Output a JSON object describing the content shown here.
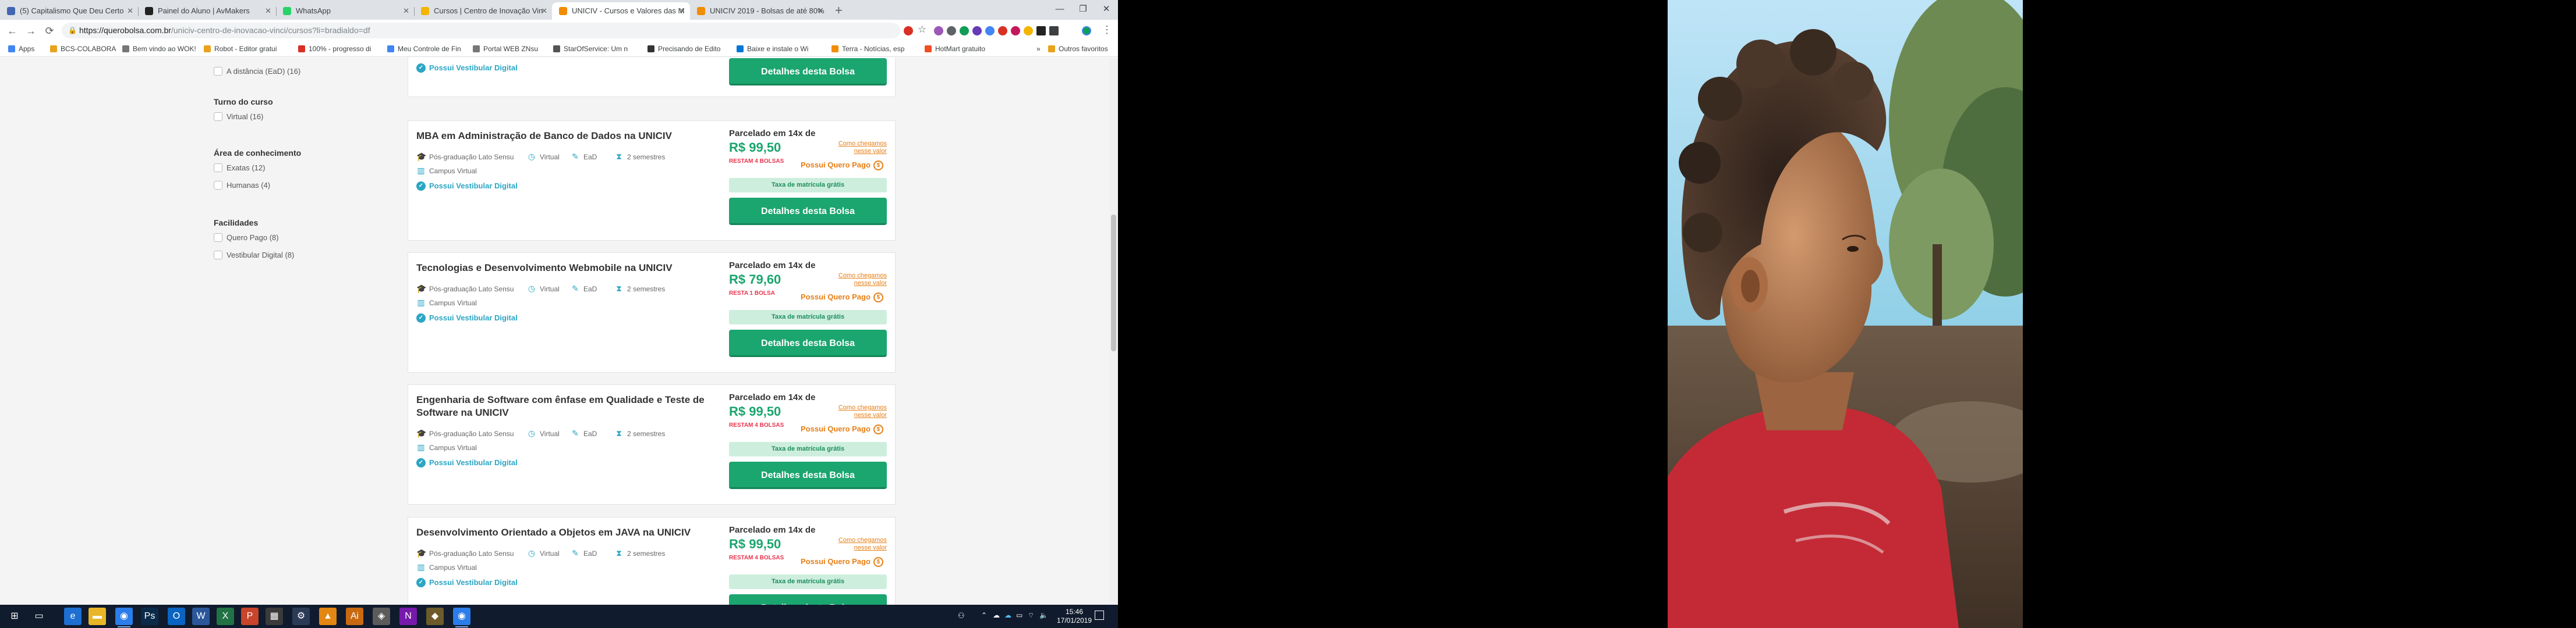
{
  "browser": {
    "tabs": [
      {
        "title": "(5) Capitalismo Que Deu Certo",
        "favicon_color": "#4267b2",
        "active": false
      },
      {
        "title": "Painel do Aluno | AvMakers",
        "favicon_color": "#222222",
        "active": false
      },
      {
        "title": "WhatsApp",
        "favicon_color": "#25d366",
        "active": false
      },
      {
        "title": "Cursos | Centro de Inovação Vin",
        "favicon_color": "#f4b400",
        "active": false
      },
      {
        "title": "UNICIV - Cursos e Valores das M",
        "favicon_color": "#f28c00",
        "active": true
      },
      {
        "title": "UNICIV 2019 - Bolsas de até 80%",
        "favicon_color": "#f28c00",
        "active": false
      }
    ],
    "new_tab": "+",
    "window_controls": {
      "minimize": "—",
      "maximize": "❐",
      "close": "✕"
    },
    "nav": {
      "back": "←",
      "forward": "→",
      "reload": "⟳"
    },
    "url": {
      "host": "https://querobolsa.com.br",
      "path": "/uniciv-centro-de-inovacao-vinci/cursos?li=bradialdo=df"
    },
    "bookmarks": [
      {
        "label": "Apps",
        "color": "#4285f4"
      },
      {
        "label": "BCS-COLABORA",
        "color": "#e8a21b"
      },
      {
        "label": "Bem vindo ao WOK!",
        "color": "#777777"
      },
      {
        "label": "Robot - Editor gratui",
        "color": "#e8a21b"
      },
      {
        "label": "100% - progresso di",
        "color": "#d93025"
      },
      {
        "label": "Meu Controle de Fin",
        "color": "#4285f4"
      },
      {
        "label": "Portal WEB ZNsu",
        "color": "#777777"
      },
      {
        "label": "StarOfService: Um n",
        "color": "#555555"
      },
      {
        "label": "Precisando de Edito",
        "color": "#333333"
      },
      {
        "label": "Baixe e instale o Wi",
        "color": "#0078d7"
      },
      {
        "label": "Terra - Notícias, esp",
        "color": "#f28c00"
      },
      {
        "label": "HotMart gratuito",
        "color": "#f04e23"
      },
      {
        "label": "»",
        "color": "#ffffff"
      },
      {
        "label": "Outros favoritos",
        "color": "#e8a21b"
      }
    ]
  },
  "sidebar": {
    "top_option": "A distância (EaD) (16)",
    "groups": [
      {
        "title": "Turno do curso",
        "options": [
          "Virtual (16)"
        ]
      },
      {
        "title": "Área de conhecimento",
        "options": [
          "Exatas (12)",
          "Humanas (4)"
        ]
      },
      {
        "title": "Facilidades",
        "options": [
          "Quero Pago (8)",
          "Vestibular Digital (8)"
        ]
      }
    ]
  },
  "top_card": {
    "vestibular": "Possui Vestibular Digital",
    "cta": "Detalhes desta Bolsa"
  },
  "courses": [
    {
      "title": "MBA em Administração de Banco de Dados na UNICIV",
      "level": "Pós-graduação Lato Sensu",
      "shift": "Virtual",
      "modality": "EaD",
      "duration": "2 semestres",
      "campus": "Campus Virtual",
      "vestibular": "Possui Vestibular Digital",
      "price_label": "Parcelado em 14x de",
      "price": "R$ 99,50",
      "remaining": "RESTAM 4 BOLSAS",
      "how_we_get_price": "Como chegamos nesse valor",
      "quero_pago": "Possui Quero Pago",
      "fee": "Taxa de matrícula grátis",
      "cta": "Detalhes desta Bolsa"
    },
    {
      "title": "Tecnologias e Desenvolvimento Webmobile na UNICIV",
      "level": "Pós-graduação Lato Sensu",
      "shift": "Virtual",
      "modality": "EaD",
      "duration": "2 semestres",
      "campus": "Campus Virtual",
      "vestibular": "Possui Vestibular Digital",
      "price_label": "Parcelado em 14x de",
      "price": "R$ 79,60",
      "remaining": "RESTA 1 BOLSA",
      "how_we_get_price": "Como chegamos nesse valor",
      "quero_pago": "Possui Quero Pago",
      "fee": "Taxa de matrícula grátis",
      "cta": "Detalhes desta Bolsa"
    },
    {
      "title": "Engenharia de Software com ênfase em Qualidade e Teste de Software na UNICIV",
      "level": "Pós-graduação Lato Sensu",
      "shift": "Virtual",
      "modality": "EaD",
      "duration": "2 semestres",
      "campus": "Campus Virtual",
      "vestibular": "Possui Vestibular Digital",
      "price_label": "Parcelado em 14x de",
      "price": "R$ 99,50",
      "remaining": "RESTAM 4 BOLSAS",
      "how_we_get_price": "Como chegamos nesse valor",
      "quero_pago": "Possui Quero Pago",
      "fee": "Taxa de matrícula grátis",
      "cta": "Detalhes desta Bolsa"
    },
    {
      "title": "Desenvolvimento Orientado a Objetos em JAVA na UNICIV",
      "level": "Pós-graduação Lato Sensu",
      "shift": "Virtual",
      "modality": "EaD",
      "duration": "2 semestres",
      "campus": "Campus Virtual",
      "vestibular": "Possui Vestibular Digital",
      "price_label": "Parcelado em 14x de",
      "price": "R$ 99,50",
      "remaining": "RESTAM 4 BOLSAS",
      "how_we_get_price": "Como chegamos nesse valor",
      "quero_pago": "Possui Quero Pago",
      "fee": "Taxa de matrícula grátis",
      "cta": "Detalhes desta Bolsa"
    }
  ],
  "taskbar": {
    "apps": [
      {
        "icon": "windows-start-icon",
        "glyph": "⊞",
        "color": "#101b2d"
      },
      {
        "icon": "task-view-icon",
        "glyph": "▭",
        "color": "#101b2d"
      },
      {
        "icon": "edge-icon",
        "glyph": "e",
        "color": "#1d6fd1"
      },
      {
        "icon": "file-explorer-icon",
        "glyph": "▬",
        "color": "#e8b626"
      },
      {
        "icon": "chrome-icon",
        "glyph": "◉",
        "color": "#2b7de9"
      },
      {
        "icon": "photoshop-icon",
        "glyph": "Ps",
        "color": "#0b2a4a"
      },
      {
        "icon": "outlook-icon",
        "glyph": "O",
        "color": "#0a64c2"
      },
      {
        "icon": "word-icon",
        "glyph": "W",
        "color": "#2b579a"
      },
      {
        "icon": "excel-icon",
        "glyph": "X",
        "color": "#217346"
      },
      {
        "icon": "powerpoint-icon",
        "glyph": "P",
        "color": "#c8442a"
      },
      {
        "icon": "calculator-icon",
        "glyph": "▦",
        "color": "#3b3b3b"
      },
      {
        "icon": "settings-icon",
        "glyph": "⚙",
        "color": "#2b3a55"
      },
      {
        "icon": "vlc-icon",
        "glyph": "▲",
        "color": "#e38612"
      },
      {
        "icon": "illustrator-icon",
        "glyph": "Ai",
        "color": "#c96a10"
      },
      {
        "icon": "photos-icon",
        "glyph": "◈",
        "color": "#5b5b5b"
      },
      {
        "icon": "onenote-icon",
        "glyph": "N",
        "color": "#7719aa"
      },
      {
        "icon": "media-icon",
        "glyph": "◆",
        "color": "#6e5b2a"
      },
      {
        "icon": "chrome-active-icon",
        "glyph": "◉",
        "color": "#2b7de9"
      }
    ],
    "clock_time": "15:46",
    "clock_date": "17/01/2019"
  }
}
